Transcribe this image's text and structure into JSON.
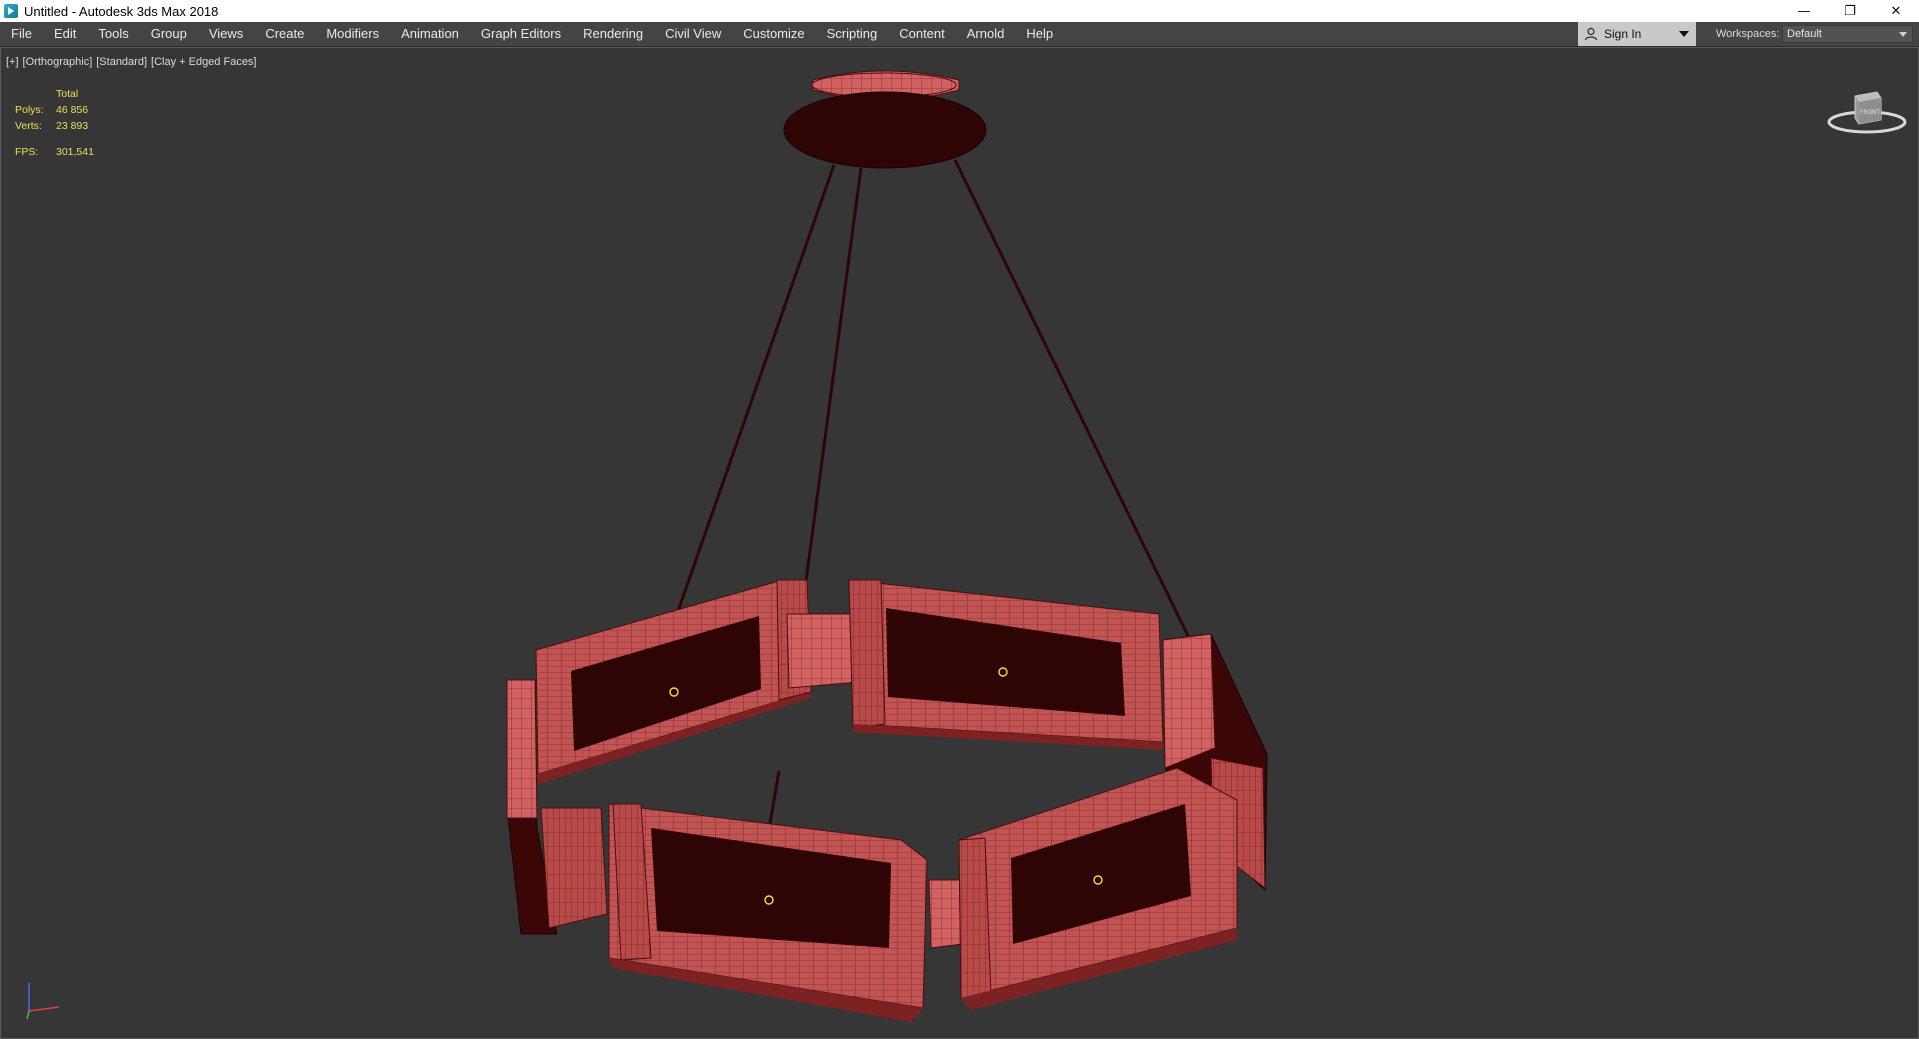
{
  "window": {
    "title": "Untitled - Autodesk 3ds Max 2018",
    "controls": {
      "minimize": "—",
      "restore": "❐",
      "close": "✕"
    }
  },
  "menu": [
    "File",
    "Edit",
    "Tools",
    "Group",
    "Views",
    "Create",
    "Modifiers",
    "Animation",
    "Graph Editors",
    "Rendering",
    "Civil View",
    "Customize",
    "Scripting",
    "Content",
    "Arnold",
    "Help"
  ],
  "account": {
    "sign_in_label": "Sign In"
  },
  "workspace": {
    "label": "Workspaces:",
    "value": "Default"
  },
  "viewport": {
    "labels": [
      "[+]",
      "[Orthographic]",
      "[Standard]",
      "[Clay + Edged Faces]"
    ],
    "stats": {
      "header": "Total",
      "polys_label": "Polys:",
      "polys": "46 856",
      "verts_label": "Verts:",
      "verts": "23 893",
      "fps_label": "FPS:",
      "fps": "301,541"
    },
    "viewcube_label": "FRONT",
    "model_color": "#c25454",
    "model_dark": "#2e0404",
    "pivot_color": "#f1e23c"
  }
}
